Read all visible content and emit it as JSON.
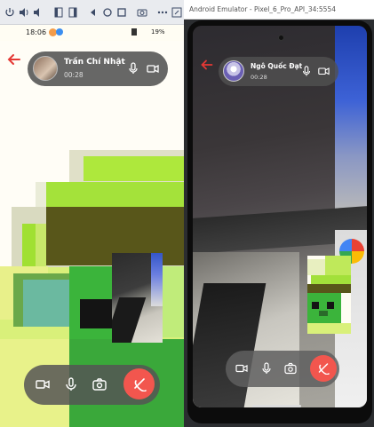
{
  "left_phone": {
    "status_time": "18:06",
    "status_right": "19%",
    "caller_name": "Trần Chí Nhật",
    "call_duration": "00:28",
    "icons": {
      "back": "arrow-left-icon",
      "mic": "microphone-icon",
      "camera": "video-camera-icon",
      "switch_camera": "camera-switch-icon",
      "hangup": "phone-hangup-icon"
    }
  },
  "right_emulator": {
    "window_title": "Android Emulator - Pixel_6_Pro_API_34:5554",
    "caller_name": "Ngô Quốc Đạt",
    "call_duration": "00:28"
  },
  "colors": {
    "hangup": "#f2564e",
    "back_arrow": "#e53935",
    "pixel_green": "#9be234",
    "pixel_olive": "#58561a"
  }
}
